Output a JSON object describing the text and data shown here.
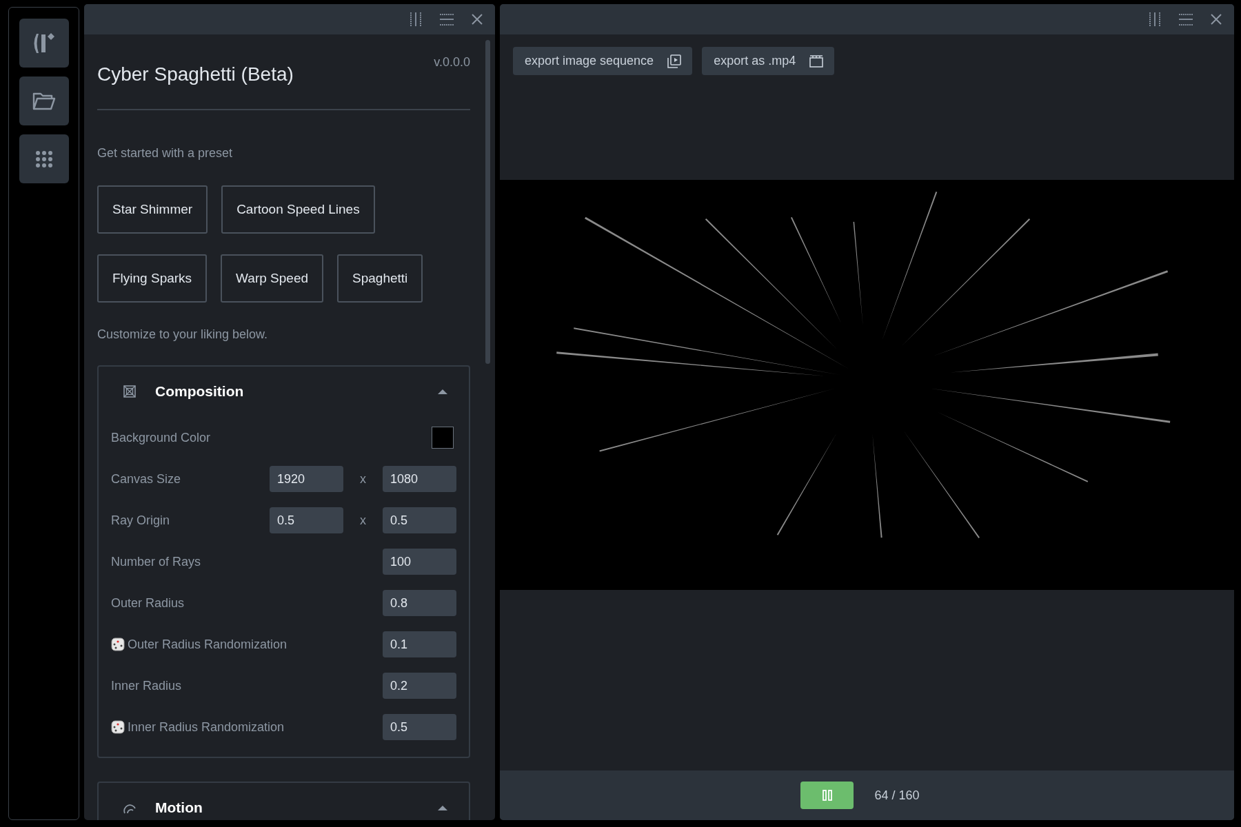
{
  "settings_panel": {
    "title": "Cyber Spaghetti (Beta)",
    "version": "v.0.0.0",
    "preset_prompt": "Get started with a preset",
    "preset_rows": [
      [
        "Star Shimmer",
        "Cartoon Speed Lines"
      ],
      [
        "Flying Sparks",
        "Warp Speed",
        "Spaghetti"
      ]
    ],
    "customize_hint": "Customize to your liking below.",
    "sections": [
      {
        "title": "Composition",
        "kind": "composition",
        "expanded": true,
        "fields": [
          {
            "label": "Background Color",
            "kind": "color",
            "randomized": false,
            "color": "#000000"
          },
          {
            "label": "Canvas Size",
            "kind": "pair",
            "randomized": false,
            "values": [
              "1920",
              "1080"
            ],
            "separator": "x"
          },
          {
            "label": "Ray Origin",
            "kind": "pair",
            "randomized": false,
            "values": [
              "0.5",
              "0.5"
            ],
            "separator": "x"
          },
          {
            "label": "Number of Rays",
            "kind": "number",
            "randomized": false,
            "value": "100"
          },
          {
            "label": "Outer Radius",
            "kind": "number",
            "randomized": false,
            "value": "0.8"
          },
          {
            "label": "Outer Radius Randomization",
            "kind": "number",
            "randomized": true,
            "value": "0.1"
          },
          {
            "label": "Inner Radius",
            "kind": "number",
            "randomized": false,
            "value": "0.2"
          },
          {
            "label": "Inner Radius Randomization",
            "kind": "number",
            "randomized": true,
            "value": "0.5"
          }
        ]
      },
      {
        "title": "Motion",
        "kind": "motion",
        "expanded": true
      }
    ]
  },
  "preview_panel": {
    "export_buttons": [
      {
        "label": "export image sequence",
        "kind": "sequence"
      },
      {
        "label": "export as .mp4",
        "kind": "video"
      }
    ],
    "playback": {
      "playing": true,
      "frame": "64 / 160"
    }
  }
}
